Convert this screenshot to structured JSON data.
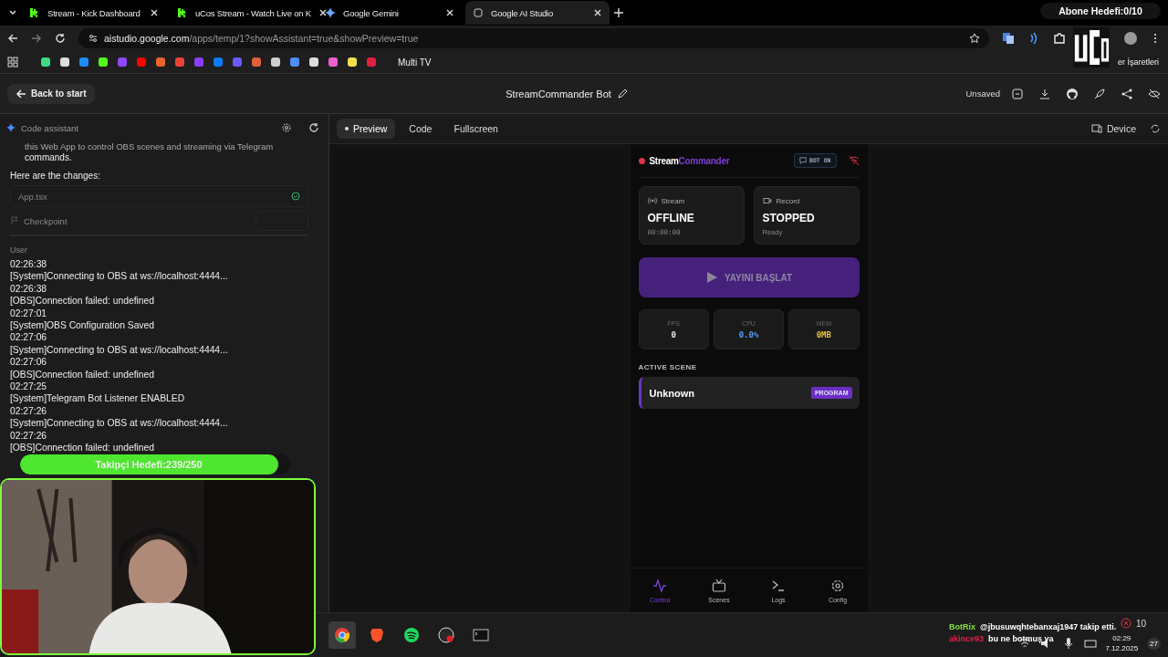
{
  "browser": {
    "tabs": [
      {
        "title": "Stream - Kick Dashboard",
        "selected": false,
        "kind": "kick"
      },
      {
        "title": "uCos Stream - Watch Live on K",
        "selected": false,
        "kind": "kick"
      },
      {
        "title": "Google Gemini",
        "selected": false,
        "kind": "gemini"
      },
      {
        "title": "Google AI Studio",
        "selected": true,
        "kind": "studio"
      }
    ],
    "url_host": "aistudio.google.com",
    "url_path": "/apps/temp/1?showAssistant=true&showPreview=true",
    "bookmark_folder": "Multi TV",
    "bookmarks_label": "er İşaretleri"
  },
  "overlay": {
    "subscriber_goal": "Abone Hedefi:0/10",
    "follower_goal": {
      "label": "Takipçi Hedefi:239/250",
      "level": 0.956
    },
    "chat": [
      {
        "user": "BotRix",
        "message": "@jbusuwqhtebanxaj1947 takip etti.",
        "color": "#7fe03a"
      },
      {
        "user": "akince93",
        "message": "bu ne botmuş ya",
        "color": "#e0204a"
      }
    ]
  },
  "header": {
    "back": "Back to start",
    "title": "StreamCommander Bot",
    "status": "Unsaved"
  },
  "assistant": {
    "title": "Code assistant",
    "cut_line": "this Web App to control OBS scenes and streaming via Telegram",
    "line_end": "commands.",
    "changes_label": "Here are the changes:",
    "file": "App.tsx",
    "checkpoint": "Checkpoint",
    "author": "User",
    "log": [
      {
        "time": "02:26:38",
        "text": "[System]Connecting to OBS at ws://localhost:4444..."
      },
      {
        "time": "02:26:38",
        "text": "[OBS]Connection failed: undefined"
      },
      {
        "time": "02:27:01",
        "text": "[System]OBS Configuration Saved"
      },
      {
        "time": "02:27:06",
        "text": "[System]Connecting to OBS at ws://localhost:4444..."
      },
      {
        "time": "02:27:06",
        "text": "[OBS]Connection failed: undefined"
      },
      {
        "time": "02:27:25",
        "text": "[System]Telegram Bot Listener ENABLED"
      },
      {
        "time": "02:27:26",
        "text": "[System]Connecting to OBS at ws://localhost:4444..."
      },
      {
        "time": "02:27:26",
        "text": "[OBS]Connection failed: undefined"
      }
    ]
  },
  "preview_bar": {
    "tabs": [
      {
        "label": "Preview",
        "selected": true
      },
      {
        "label": "Code",
        "selected": false
      },
      {
        "label": "Fullscreen",
        "selected": false
      }
    ],
    "device": "Device"
  },
  "app": {
    "brand_first": "Stream",
    "brand_second": "Commander",
    "bot_badge": "BOT ON",
    "cards": [
      {
        "kind": "stream",
        "label": "Stream",
        "value": "OFFLINE",
        "sub": "00:00:00"
      },
      {
        "kind": "record",
        "label": "Record",
        "value": "STOPPED",
        "sub": "Ready"
      }
    ],
    "start_button": "YAYINI BAŞLAT",
    "stats": [
      {
        "label": "FPS",
        "value": "0",
        "color": "#e8e8e8"
      },
      {
        "label": "CPU",
        "value": "0.0%",
        "color": "#5b9cf0"
      },
      {
        "label": "MEM",
        "value": "0MB",
        "color": "#e8c040"
      }
    ],
    "scene_heading": "ACTIVE SCENE",
    "scene": "Unknown",
    "scene_badge": "PROGRAM",
    "nav": [
      {
        "label": "Control",
        "kind": "pulse",
        "selected": true
      },
      {
        "label": "Scenes",
        "kind": "tv",
        "selected": false
      },
      {
        "label": "Logs",
        "kind": "terminal",
        "selected": false
      },
      {
        "label": "Config",
        "kind": "gear",
        "selected": false
      }
    ]
  },
  "taskbar": {
    "apps": [
      {
        "kind": "chrome",
        "selected": true
      },
      {
        "kind": "brave",
        "selected": false
      },
      {
        "kind": "spotify",
        "selected": false
      },
      {
        "kind": "obs",
        "selected": false
      },
      {
        "kind": "terminal",
        "selected": false
      }
    ],
    "error_count": "10",
    "time": "02:29",
    "date": "7.12.2025",
    "notifications": "27"
  }
}
